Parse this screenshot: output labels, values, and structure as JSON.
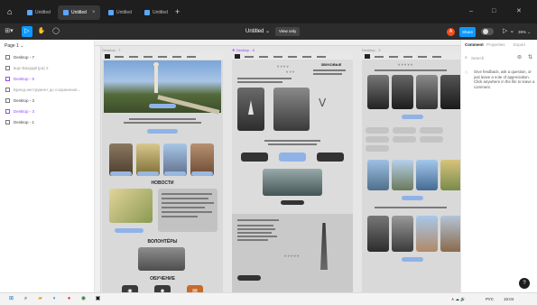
{
  "titlebar": {
    "tabs": [
      {
        "label": "Untitled",
        "active": false
      },
      {
        "label": "Untitled",
        "active": true
      },
      {
        "label": "Untitled",
        "active": false
      },
      {
        "label": "Untitled",
        "active": false
      }
    ],
    "new_tab": "+",
    "minimize": "–",
    "maximize": "□",
    "close": "✕"
  },
  "toolbar": {
    "main_menu": "⊞▾",
    "move_tool": "▷",
    "hand_tool": "✋",
    "comment_tool": "◯",
    "file_title": "Untitled ⌄",
    "view_only": "View only",
    "share": "Share",
    "avatar_initial": "A",
    "present": "▷ ⌄",
    "zoom": "39% ⌄"
  },
  "left_panel": {
    "page": "Page 1 ⌄",
    "layers": [
      {
        "label": "Desktop - 7",
        "style": "normal"
      },
      {
        "label": "вщп Вахрдйг(ра) 2",
        "style": "dim"
      },
      {
        "label": "Desktop - 5",
        "style": "purple"
      },
      {
        "label": "Бренд инструмент до сохранения...",
        "style": "dim"
      },
      {
        "label": "Desktop - 3",
        "style": "normal"
      },
      {
        "label": "Desktop - 3",
        "style": "purple"
      },
      {
        "label": "Desktop - 1",
        "style": "normal"
      }
    ]
  },
  "canvas": {
    "frames": [
      {
        "label": "Desktop - 7",
        "highlight": false
      },
      {
        "label": "❖ Desktop - 5",
        "highlight": true
      },
      {
        "label": "Desktop - 3",
        "highlight": false
      }
    ],
    "frame1": {
      "news_heading": "НОВОСТИ",
      "volunteers_heading": "ВОЛОНТЁРЫ",
      "education_heading": "ОБУЧЕНИЕ"
    },
    "frame2": {
      "header_heading": "ЗВУКОВЫЕ"
    }
  },
  "right_panel": {
    "tabs": [
      "Comment",
      "Properties",
      "Export"
    ],
    "search_placeholder": "Search",
    "empty_text": "Give feedback, ask a question, or just leave a note of appreciation. Click anywhere in the file to leave a comment."
  },
  "help": "?",
  "taskbar": {
    "tray_lang": "РУС",
    "tray_time": "15:04",
    "tray_icons": "∧ ☁ 🔊"
  },
  "colors": {
    "accent": "#0d99ff",
    "titlebar_bg": "#1e1e1e",
    "toolbar_bg": "#2c2c2c",
    "component_purple": "#9747ff",
    "avatar": "#f24e1e"
  }
}
